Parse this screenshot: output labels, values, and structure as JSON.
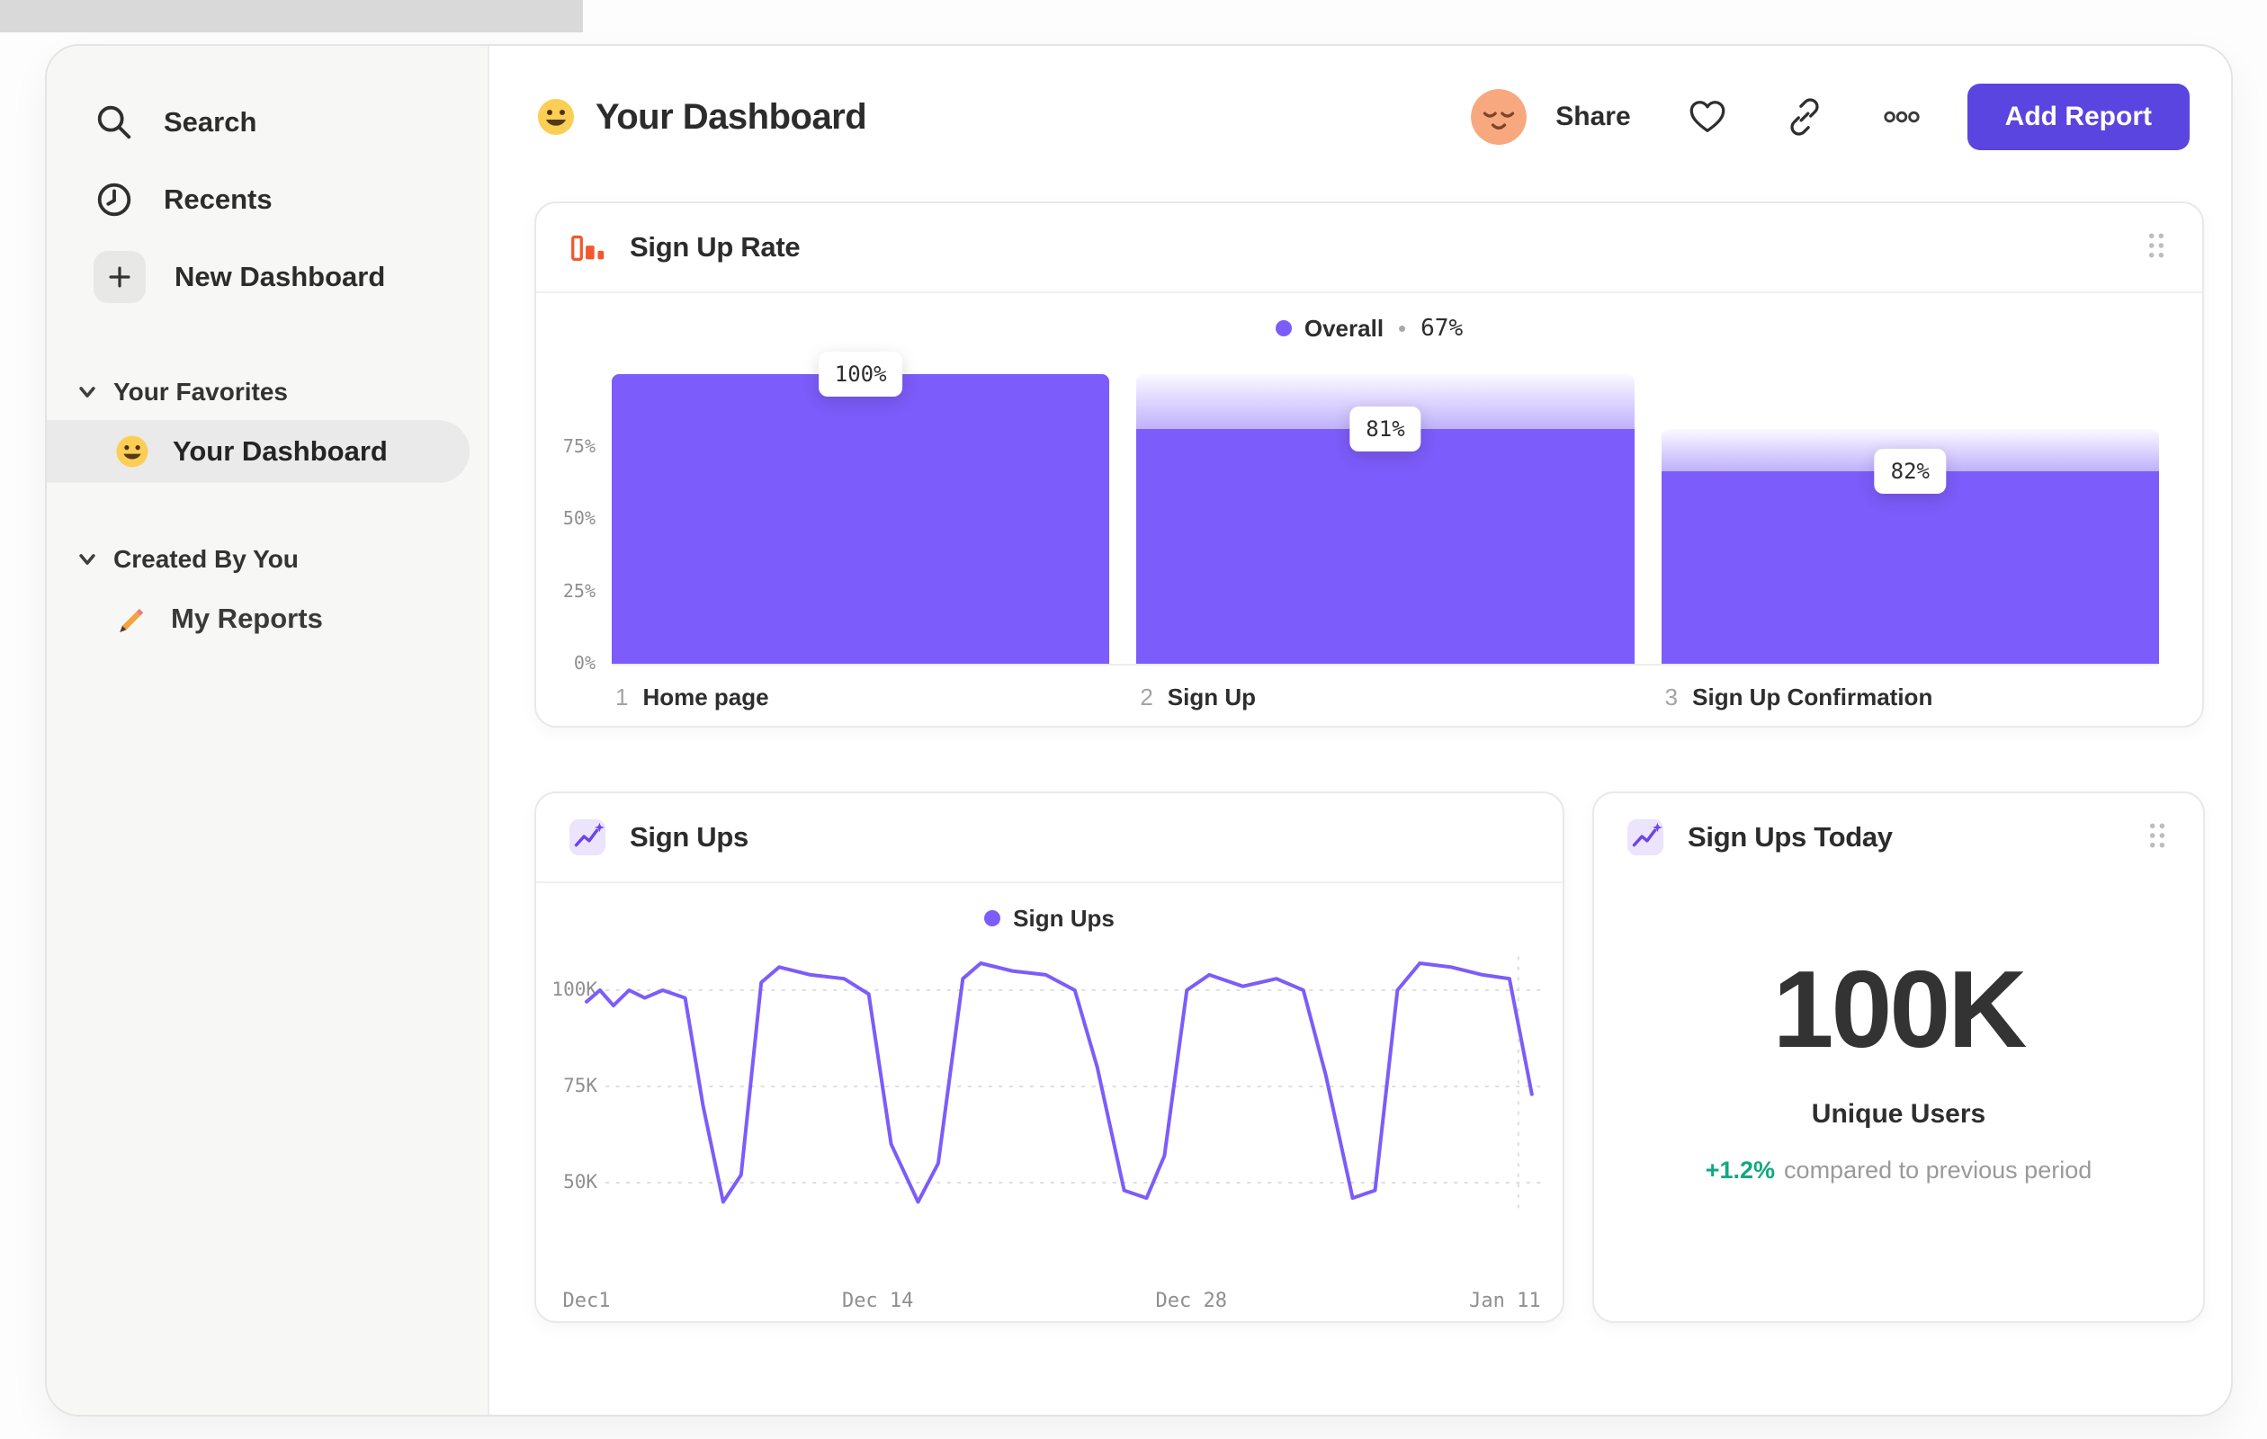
{
  "sidebar": {
    "items": [
      {
        "label": "Search",
        "icon": "search-icon"
      },
      {
        "label": "Recents",
        "icon": "clock-icon"
      },
      {
        "label": "New Dashboard",
        "icon": "plus-icon"
      }
    ],
    "sections": [
      {
        "title": "Your Favorites",
        "items": [
          {
            "label": "Your Dashboard",
            "icon": "smiley-emoji-icon",
            "selected": true
          }
        ]
      },
      {
        "title": "Created By You",
        "items": [
          {
            "label": "My Reports",
            "icon": "pencil-emoji-icon",
            "selected": false
          }
        ]
      }
    ]
  },
  "header": {
    "title": "Your Dashboard",
    "share_label": "Share",
    "add_report_label": "Add Report"
  },
  "funnel_card": {
    "title": "Sign Up Rate",
    "legend_name": "Overall",
    "legend_separator": "•",
    "legend_value": "67%"
  },
  "line_card": {
    "title": "Sign Ups",
    "legend_name": "Sign Ups"
  },
  "metric_card": {
    "title": "Sign Ups Today",
    "value": "100K",
    "unit_label": "Unique Users",
    "delta": "+1.2%",
    "delta_note": "compared to previous period"
  },
  "colors": {
    "accent": "#7c5cfa",
    "button": "#5b45e0",
    "positive": "#12a87e",
    "funnel_icon_orange": "#f2582e",
    "grid": "#dedede"
  },
  "chart_data": [
    {
      "id": "signup-rate-funnel",
      "type": "bar",
      "title": "Sign Up Rate",
      "legend": "Overall • 67%",
      "y_axis": [
        {
          "label": "75%",
          "value": 75
        },
        {
          "label": "50%",
          "value": 50
        },
        {
          "label": "25%",
          "value": 25
        },
        {
          "label": "0%",
          "value": 0
        }
      ],
      "steps": [
        {
          "step": "1",
          "label": "Home page",
          "value_label": "100%",
          "conversion_pct": 100,
          "overall_pct": 100,
          "cap_from_pct": 100
        },
        {
          "step": "2",
          "label": "Sign Up",
          "value_label": "81%",
          "conversion_pct": 81,
          "overall_pct": 81,
          "cap_from_pct": 100
        },
        {
          "step": "3",
          "label": "Sign Up Confirmation",
          "value_label": "82%",
          "conversion_pct": 82,
          "overall_pct": 66.4,
          "cap_from_pct": 81
        }
      ]
    },
    {
      "id": "signups-line",
      "type": "line",
      "title": "Sign Ups",
      "y_unit": "K",
      "ylim": [
        40,
        112
      ],
      "y_axis": [
        {
          "label": "100K",
          "value": 100
        },
        {
          "label": "75K",
          "value": 75
        },
        {
          "label": "50K",
          "value": 50
        }
      ],
      "x_axis": [
        {
          "label": "Dec1",
          "day": 0
        },
        {
          "label": "Dec 14",
          "day": 13
        },
        {
          "label": "Dec 28",
          "day": 27
        },
        {
          "label": "Jan 11",
          "day": 41
        }
      ],
      "marker_day": 41.6,
      "series": [
        {
          "name": "Sign Ups",
          "points": [
            [
              0,
              97
            ],
            [
              0.6,
              100
            ],
            [
              1.2,
              96
            ],
            [
              1.9,
              100
            ],
            [
              2.6,
              98
            ],
            [
              3.4,
              100
            ],
            [
              4.4,
              98
            ],
            [
              5.2,
              70
            ],
            [
              6.1,
              45
            ],
            [
              6.9,
              52
            ],
            [
              7.8,
              102
            ],
            [
              8.6,
              106
            ],
            [
              10,
              104
            ],
            [
              11.5,
              103
            ],
            [
              12.6,
              99
            ],
            [
              13.6,
              60
            ],
            [
              14.8,
              45
            ],
            [
              15.7,
              55
            ],
            [
              16.8,
              103
            ],
            [
              17.6,
              107
            ],
            [
              19,
              105
            ],
            [
              20.5,
              104
            ],
            [
              21.8,
              100
            ],
            [
              22.8,
              80
            ],
            [
              24,
              48
            ],
            [
              25,
              46
            ],
            [
              25.8,
              57
            ],
            [
              26.8,
              100
            ],
            [
              27.8,
              104
            ],
            [
              29.3,
              101
            ],
            [
              30.8,
              103
            ],
            [
              32,
              100
            ],
            [
              33,
              78
            ],
            [
              34.2,
              46
            ],
            [
              35.2,
              48
            ],
            [
              36.2,
              100
            ],
            [
              37.2,
              107
            ],
            [
              38.6,
              106
            ],
            [
              40,
              104
            ],
            [
              41.2,
              103
            ],
            [
              42.2,
              73
            ]
          ]
        }
      ]
    }
  ]
}
